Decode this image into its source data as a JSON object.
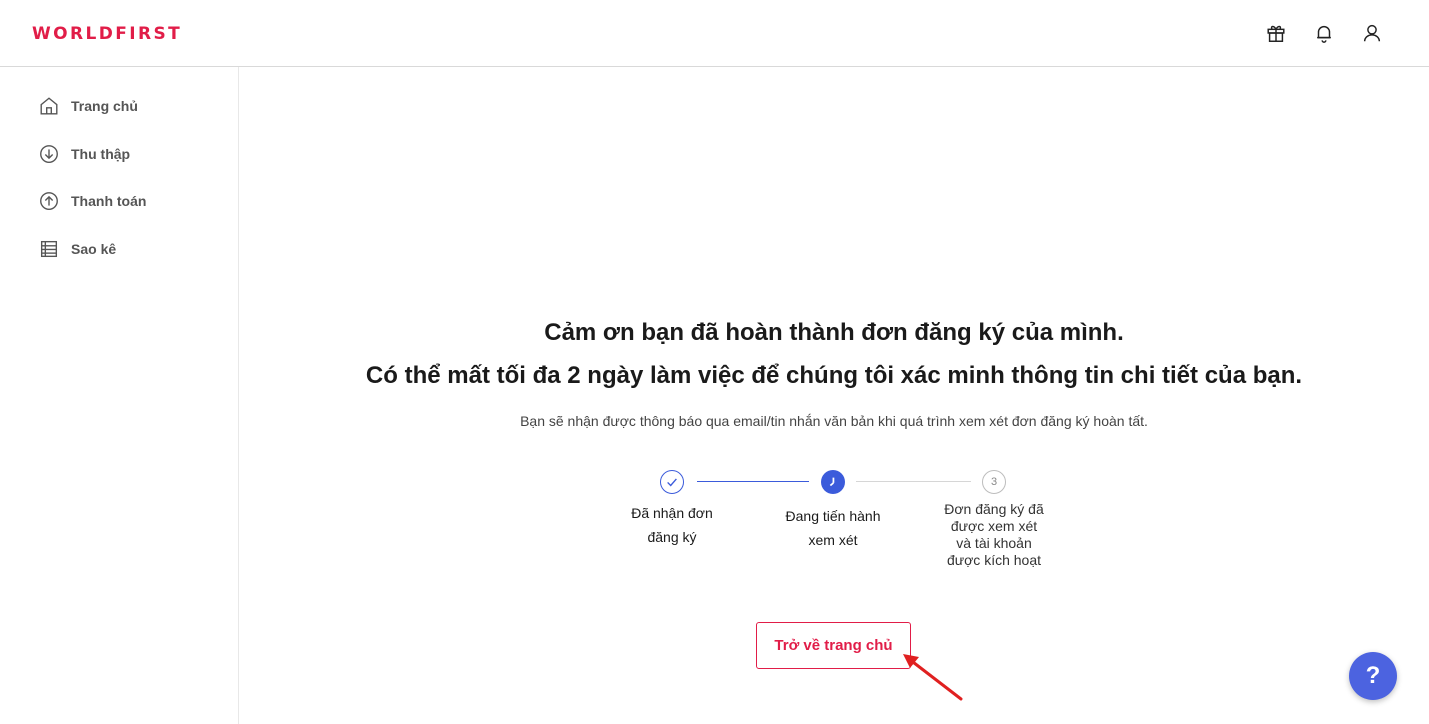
{
  "header": {
    "logo_text": "WORLDFIRST",
    "icons": [
      "gift-icon",
      "bell-icon",
      "user-icon"
    ],
    "brand_color": "#e11d48"
  },
  "sidebar": {
    "items": [
      {
        "label": "Trang chủ",
        "icon": "home-icon"
      },
      {
        "label": "Thu thập",
        "icon": "download-circle-icon"
      },
      {
        "label": "Thanh toán",
        "icon": "upload-circle-icon"
      },
      {
        "label": "Sao kê",
        "icon": "statement-icon"
      }
    ]
  },
  "main": {
    "heading_line1": "Cảm ơn bạn đã hoàn thành đơn đăng ký của mình.",
    "heading_line2": "Có thể mất tối đa 2 ngày làm việc để chúng tôi xác minh thông tin chi tiết của bạn.",
    "subtext": "Bạn sẽ nhận được thông báo qua email/tin nhắn văn bản khi quá trình xem xét đơn đăng ký hoàn tất.",
    "steps": [
      {
        "lines": [
          "Đã nhận đơn",
          "đăng ký"
        ],
        "state": "completed",
        "icon": "check-icon"
      },
      {
        "lines": [
          "Đang tiến hành",
          "xem xét"
        ],
        "state": "in-progress",
        "icon": "clock-icon"
      },
      {
        "number": "3",
        "lines": [
          "Đơn đăng ký đã",
          "được xem xét",
          "và tài khoản",
          "được kích hoạt"
        ],
        "state": "pending"
      }
    ],
    "back_home_button": "Trở về trang chủ",
    "accent_color": "#3b5bdb"
  },
  "help_button": {
    "label": "?",
    "color": "#4c63e0"
  }
}
